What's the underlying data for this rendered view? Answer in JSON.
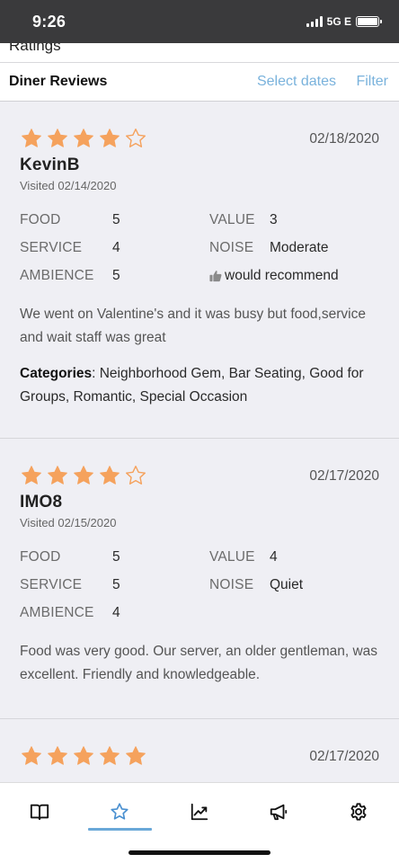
{
  "status_bar": {
    "time": "9:26",
    "network": "5G E"
  },
  "top_strip": {
    "title": "Ratings"
  },
  "header": {
    "title": "Diner Reviews",
    "select_dates": "Select dates",
    "filter": "Filter"
  },
  "colors": {
    "star": "#f5a25d",
    "link": "#79b2dc",
    "active_tab": "#6aa8d8"
  },
  "labels": {
    "food": "FOOD",
    "service": "SERVICE",
    "ambience": "AMBIENCE",
    "value": "VALUE",
    "noise": "NOISE",
    "categories": "Categories"
  },
  "reviews": [
    {
      "stars": 4,
      "date": "02/18/2020",
      "name": "KevinB",
      "visited": "Visited 02/14/2020",
      "food": "5",
      "service": "4",
      "ambience": "5",
      "value": "3",
      "noise": "Moderate",
      "recommend": "would recommend",
      "text": "We went on Valentine's and it was busy but food,service and wait staff was great",
      "categories": ": Neighborhood Gem, Bar Seating, Good for Groups, Romantic, Special Occasion"
    },
    {
      "stars": 4,
      "date": "02/17/2020",
      "name": "IMO8",
      "visited": "Visited 02/15/2020",
      "food": "5",
      "service": "5",
      "ambience": "4",
      "value": "4",
      "noise": "Quiet",
      "text": "Food was very good. Our server, an older gentleman, was excellent. Friendly and knowledgeable."
    },
    {
      "stars": 5,
      "date": "02/17/2020"
    }
  ],
  "tabs": [
    {
      "icon": "book-icon",
      "active": false
    },
    {
      "icon": "star-icon",
      "active": true
    },
    {
      "icon": "chart-trend-icon",
      "active": false
    },
    {
      "icon": "megaphone-icon",
      "active": false
    },
    {
      "icon": "gear-icon",
      "active": false
    }
  ]
}
